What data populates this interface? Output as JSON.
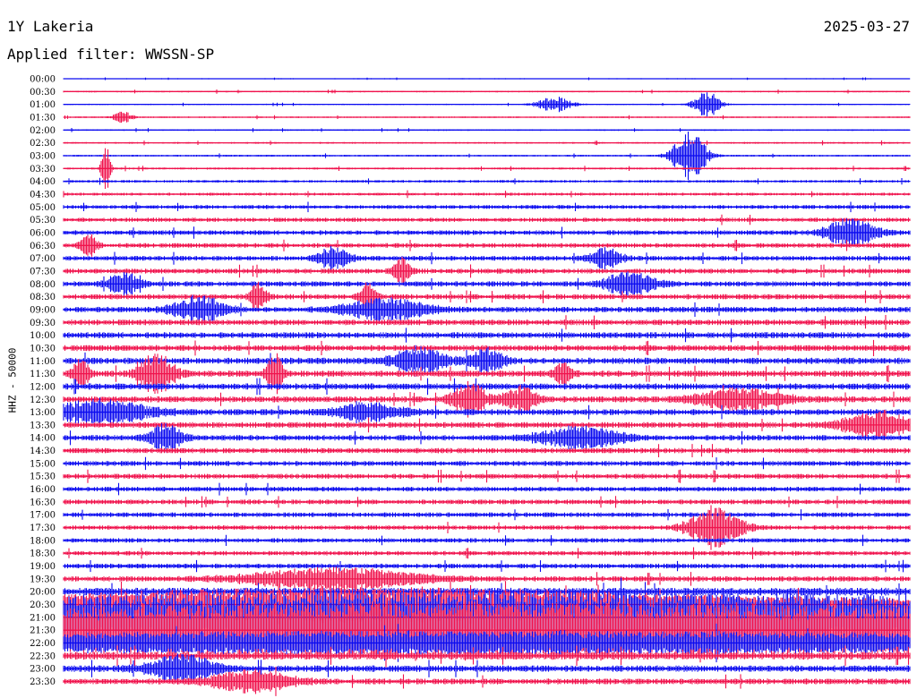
{
  "header": {
    "station": "1Y Lakeria",
    "date": "2025-03-27",
    "filter": "Applied filter: WWSSN-SP"
  },
  "colors": {
    "blue": "#0a0af0",
    "red": "#f0134d"
  },
  "chart_data": {
    "type": "line",
    "title": "1Y Lakeria",
    "ylabel": "HHZ - 50000",
    "row_labels": [
      "00:00",
      "00:30",
      "01:00",
      "01:30",
      "02:00",
      "02:30",
      "03:00",
      "03:30",
      "04:00",
      "04:30",
      "05:00",
      "05:30",
      "06:00",
      "06:30",
      "07:00",
      "07:30",
      "08:00",
      "08:30",
      "09:00",
      "09:30",
      "10:00",
      "10:30",
      "11:00",
      "11:30",
      "12:00",
      "12:30",
      "13:00",
      "13:30",
      "14:00",
      "14:30",
      "15:00",
      "15:30",
      "16:00",
      "16:30",
      "17:00",
      "17:30",
      "18:00",
      "18:30",
      "19:00",
      "19:30",
      "20:00",
      "20:30",
      "21:00",
      "21:30",
      "22:00",
      "22:30",
      "23:00",
      "23:30"
    ],
    "row_colors": [
      "blue",
      "red"
    ],
    "noise_level": [
      0.4,
      0.6,
      0.5,
      0.6,
      0.6,
      0.7,
      0.7,
      0.8,
      1.0,
      1.1,
      1.5,
      1.6,
      1.8,
      1.8,
      1.8,
      1.9,
      2.0,
      2.0,
      2.1,
      2.2,
      2.3,
      2.3,
      2.4,
      2.4,
      2.4,
      2.3,
      2.3,
      2.2,
      2.1,
      2.0,
      1.9,
      1.9,
      1.8,
      1.8,
      1.8,
      1.7,
      1.7,
      1.7,
      1.8,
      2.0,
      3.0,
      4.5,
      6.0,
      6.0,
      4.0,
      3.0,
      2.5,
      2.2
    ],
    "events": [
      {
        "row": 2,
        "x": 0.58,
        "amp": 6,
        "dur": 0.02
      },
      {
        "row": 2,
        "x": 0.76,
        "amp": 10,
        "dur": 0.015
      },
      {
        "row": 3,
        "x": 0.07,
        "amp": 5,
        "dur": 0.01
      },
      {
        "row": 6,
        "x": 0.74,
        "amp": 18,
        "dur": 0.02
      },
      {
        "row": 7,
        "x": 0.05,
        "amp": 20,
        "dur": 0.005
      },
      {
        "row": 12,
        "x": 0.93,
        "amp": 10,
        "dur": 0.03
      },
      {
        "row": 13,
        "x": 0.03,
        "amp": 8,
        "dur": 0.01
      },
      {
        "row": 14,
        "x": 0.32,
        "amp": 8,
        "dur": 0.02
      },
      {
        "row": 14,
        "x": 0.64,
        "amp": 7,
        "dur": 0.02
      },
      {
        "row": 15,
        "x": 0.4,
        "amp": 10,
        "dur": 0.01
      },
      {
        "row": 16,
        "x": 0.07,
        "amp": 8,
        "dur": 0.02
      },
      {
        "row": 16,
        "x": 0.67,
        "amp": 9,
        "dur": 0.03
      },
      {
        "row": 17,
        "x": 0.23,
        "amp": 10,
        "dur": 0.01
      },
      {
        "row": 17,
        "x": 0.36,
        "amp": 10,
        "dur": 0.01
      },
      {
        "row": 18,
        "x": 0.16,
        "amp": 10,
        "dur": 0.03
      },
      {
        "row": 18,
        "x": 0.38,
        "amp": 8,
        "dur": 0.05
      },
      {
        "row": 22,
        "x": 0.42,
        "amp": 10,
        "dur": 0.03
      },
      {
        "row": 22,
        "x": 0.5,
        "amp": 9,
        "dur": 0.02
      },
      {
        "row": 23,
        "x": 0.02,
        "amp": 12,
        "dur": 0.01
      },
      {
        "row": 23,
        "x": 0.11,
        "amp": 16,
        "dur": 0.02
      },
      {
        "row": 23,
        "x": 0.25,
        "amp": 14,
        "dur": 0.01
      },
      {
        "row": 23,
        "x": 0.59,
        "amp": 8,
        "dur": 0.01
      },
      {
        "row": 25,
        "x": 0.48,
        "amp": 12,
        "dur": 0.02
      },
      {
        "row": 25,
        "x": 0.54,
        "amp": 9,
        "dur": 0.02
      },
      {
        "row": 25,
        "x": 0.8,
        "amp": 8,
        "dur": 0.05
      },
      {
        "row": 26,
        "x": 0.04,
        "amp": 9,
        "dur": 0.06
      },
      {
        "row": 26,
        "x": 0.36,
        "amp": 7,
        "dur": 0.04
      },
      {
        "row": 27,
        "x": 0.96,
        "amp": 10,
        "dur": 0.04
      },
      {
        "row": 28,
        "x": 0.12,
        "amp": 10,
        "dur": 0.02
      },
      {
        "row": 28,
        "x": 0.61,
        "amp": 8,
        "dur": 0.05
      },
      {
        "row": 35,
        "x": 0.77,
        "amp": 16,
        "dur": 0.03
      },
      {
        "row": 39,
        "x": 0.32,
        "amp": 8,
        "dur": 0.1
      },
      {
        "row": 41,
        "x": 0.35,
        "amp": 10,
        "dur": 0.4
      },
      {
        "row": 42,
        "x": 0.5,
        "amp": 16,
        "dur": 0.9
      },
      {
        "row": 43,
        "x": 0.5,
        "amp": 18,
        "dur": 0.9
      },
      {
        "row": 44,
        "x": 0.5,
        "amp": 6,
        "dur": 0.9
      },
      {
        "row": 46,
        "x": 0.14,
        "amp": 10,
        "dur": 0.04
      },
      {
        "row": 47,
        "x": 0.22,
        "amp": 8,
        "dur": 0.05
      }
    ]
  }
}
